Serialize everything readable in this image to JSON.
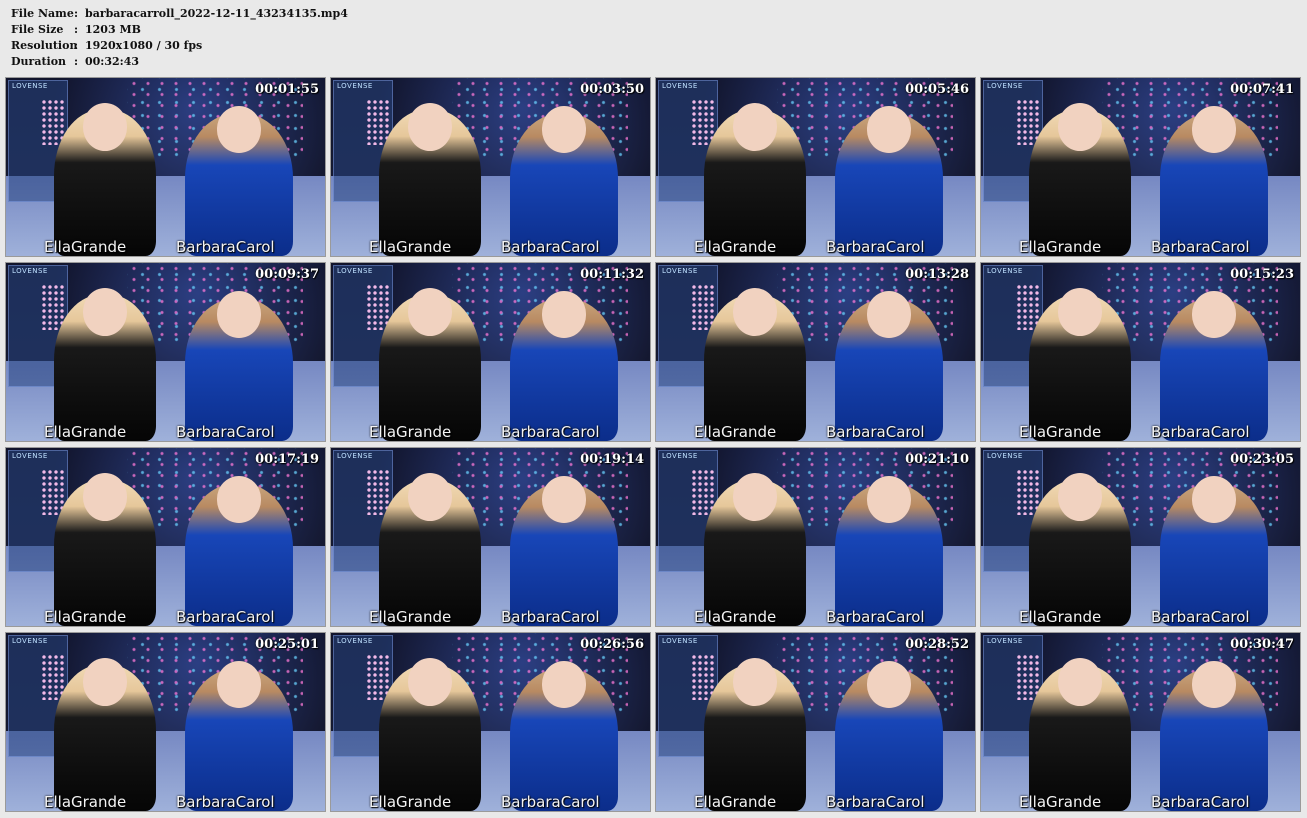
{
  "file_info": {
    "rows": [
      {
        "key": "File Name",
        "sep": ":",
        "value": "barbaracarroll_2022-12-11_43234135.mp4"
      },
      {
        "key": "File Size",
        "sep": ":",
        "value": "1203 MB"
      },
      {
        "key": "Resolution",
        "sep": ":",
        "value": "1920x1080 / 30 fps"
      },
      {
        "key": "Duration",
        "sep": ":",
        "value": "00:32:43"
      }
    ]
  },
  "overlay": {
    "panel_logo": "LOVENSE",
    "left_name": "EllaGrande",
    "right_name": "BarbaraCarol"
  },
  "thumbnails": [
    {
      "timestamp": "00:01:55"
    },
    {
      "timestamp": "00:03:50"
    },
    {
      "timestamp": "00:05:46"
    },
    {
      "timestamp": "00:07:41"
    },
    {
      "timestamp": "00:09:37"
    },
    {
      "timestamp": "00:11:32"
    },
    {
      "timestamp": "00:13:28"
    },
    {
      "timestamp": "00:15:23"
    },
    {
      "timestamp": "00:17:19"
    },
    {
      "timestamp": "00:19:14"
    },
    {
      "timestamp": "00:21:10"
    },
    {
      "timestamp": "00:23:05"
    },
    {
      "timestamp": "00:25:01"
    },
    {
      "timestamp": "00:26:56"
    },
    {
      "timestamp": "00:28:52"
    },
    {
      "timestamp": "00:30:47"
    }
  ],
  "colors": {
    "page_background": "#e9e9e9",
    "header_text": "#111111",
    "timestamp_text": "#ffffff",
    "left_outfit": "#050505",
    "right_outfit": "#1846b8"
  }
}
